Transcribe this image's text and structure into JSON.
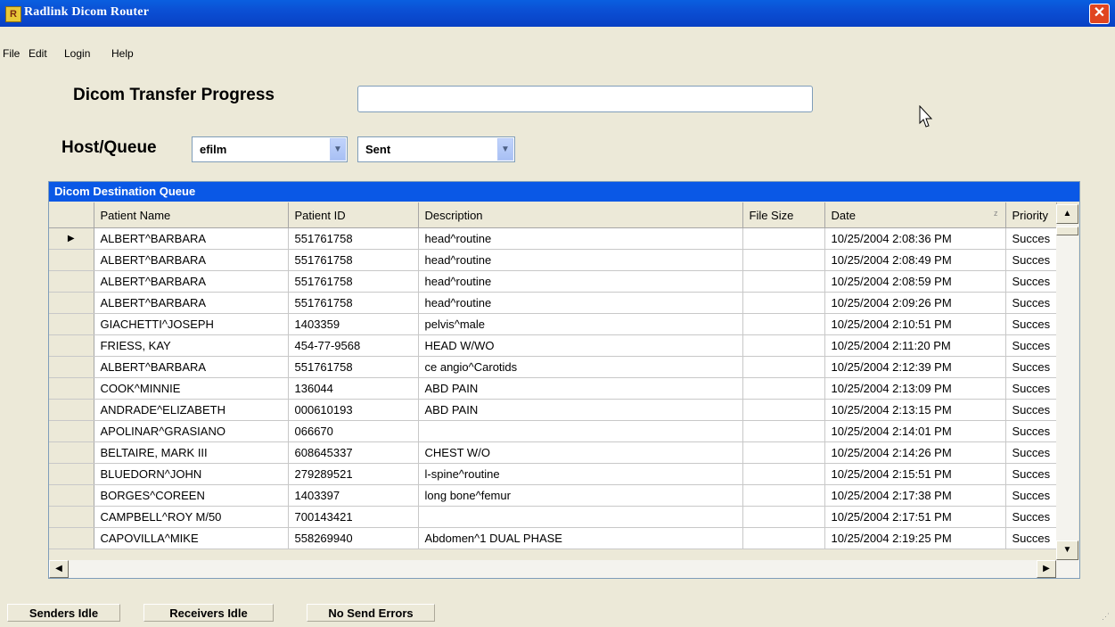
{
  "window": {
    "title": "Radlink Dicom Router"
  },
  "menu": [
    "File",
    "Edit",
    "Login",
    "Help"
  ],
  "progress": {
    "label": "Dicom Transfer Progress",
    "value": ""
  },
  "host_queue": {
    "label": "Host/Queue",
    "host": "efilm",
    "queue": "Sent"
  },
  "grid": {
    "caption": "Dicom Destination Queue",
    "columns": [
      "Patient Name",
      "Patient ID",
      "Description",
      "File Size",
      "Date",
      "Priority"
    ],
    "sort_indicator": "z",
    "rows": [
      [
        "ALBERT^BARBARA",
        "551761758",
        "head^routine",
        "",
        "10/25/2004 2:08:36 PM",
        "Succes"
      ],
      [
        "ALBERT^BARBARA",
        "551761758",
        "head^routine",
        "",
        "10/25/2004 2:08:49 PM",
        "Succes"
      ],
      [
        "ALBERT^BARBARA",
        "551761758",
        "head^routine",
        "",
        "10/25/2004 2:08:59 PM",
        "Succes"
      ],
      [
        "ALBERT^BARBARA",
        "551761758",
        "head^routine",
        "",
        "10/25/2004 2:09:26 PM",
        "Succes"
      ],
      [
        "GIACHETTI^JOSEPH",
        "1403359",
        "pelvis^male",
        "",
        "10/25/2004 2:10:51 PM",
        "Succes"
      ],
      [
        "FRIESS, KAY",
        "454-77-9568",
        "HEAD W/WO",
        "",
        "10/25/2004 2:11:20 PM",
        "Succes"
      ],
      [
        "ALBERT^BARBARA",
        "551761758",
        "ce angio^Carotids",
        "",
        "10/25/2004 2:12:39 PM",
        "Succes"
      ],
      [
        "COOK^MINNIE",
        "136044",
        "ABD PAIN",
        "",
        "10/25/2004 2:13:09 PM",
        "Succes"
      ],
      [
        "ANDRADE^ELIZABETH",
        "000610193",
        "ABD PAIN",
        "",
        "10/25/2004 2:13:15 PM",
        "Succes"
      ],
      [
        "APOLINAR^GRASIANO",
        "066670",
        "",
        "",
        "10/25/2004 2:14:01 PM",
        "Succes"
      ],
      [
        "BELTAIRE, MARK III",
        "608645337",
        "CHEST W/O",
        "",
        "10/25/2004 2:14:26 PM",
        "Succes"
      ],
      [
        "BLUEDORN^JOHN",
        "279289521",
        "l-spine^routine",
        "",
        "10/25/2004 2:15:51 PM",
        "Succes"
      ],
      [
        "BORGES^COREEN",
        "1403397",
        "long bone^femur",
        "",
        "10/25/2004 2:17:38 PM",
        "Succes"
      ],
      [
        "CAMPBELL^ROY M/50",
        "700143421",
        "",
        "",
        "10/25/2004 2:17:51 PM",
        "Succes"
      ],
      [
        "CAPOVILLA^MIKE",
        "558269940",
        "Abdomen^1 DUAL PHASE",
        "",
        "10/25/2004 2:19:25 PM",
        "Succes"
      ]
    ]
  },
  "status": [
    "Senders Idle",
    "Receivers Idle",
    "No Send Errors"
  ],
  "colors": {
    "titlebar": "#0A5FE0",
    "caption": "#0A58E6",
    "window_bg": "#ECE9D8"
  }
}
